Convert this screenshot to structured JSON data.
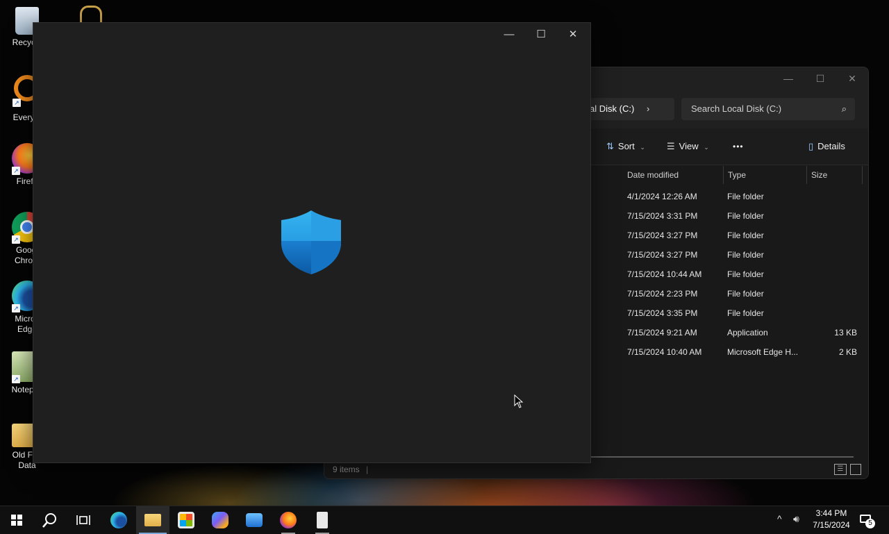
{
  "desktop": {
    "icons": [
      {
        "label": "Recycle"
      },
      {
        "label": "Everyth"
      },
      {
        "label": "Firefo"
      },
      {
        "label": "Googl\nChrom"
      },
      {
        "label": "Micros\nEdge"
      },
      {
        "label": "Notepac"
      },
      {
        "label": "Old Fire\nData"
      }
    ]
  },
  "explorer": {
    "address": "al Disk (C:)",
    "search_placeholder": "Search Local Disk (C:)",
    "commands": {
      "sort": "Sort",
      "view": "View",
      "more": "•••",
      "details": "Details"
    },
    "columns": {
      "date": "Date modified",
      "type": "Type",
      "size": "Size"
    },
    "rows": [
      {
        "date": "4/1/2024 12:26 AM",
        "type": "File folder",
        "size": ""
      },
      {
        "date": "7/15/2024 3:31 PM",
        "type": "File folder",
        "size": ""
      },
      {
        "date": "7/15/2024 3:27 PM",
        "type": "File folder",
        "size": ""
      },
      {
        "date": "7/15/2024 3:27 PM",
        "type": "File folder",
        "size": ""
      },
      {
        "date": "7/15/2024 10:44 AM",
        "type": "File folder",
        "size": ""
      },
      {
        "date": "7/15/2024 2:23 PM",
        "type": "File folder",
        "size": ""
      },
      {
        "date": "7/15/2024 3:35 PM",
        "type": "File folder",
        "size": ""
      },
      {
        "date": "7/15/2024 9:21 AM",
        "type": "Application",
        "size": "13 KB"
      },
      {
        "date": "7/15/2024 10:40 AM",
        "type": "Microsoft Edge H...",
        "size": "2 KB"
      }
    ],
    "status": "9 items"
  },
  "taskbar": {
    "time": "3:44 PM",
    "date": "7/15/2024",
    "notification_count": "5"
  },
  "colors": {
    "shield_light": "#2aa3e6",
    "shield_dark": "#0f6cbd",
    "accent": "#7aa7d8"
  }
}
